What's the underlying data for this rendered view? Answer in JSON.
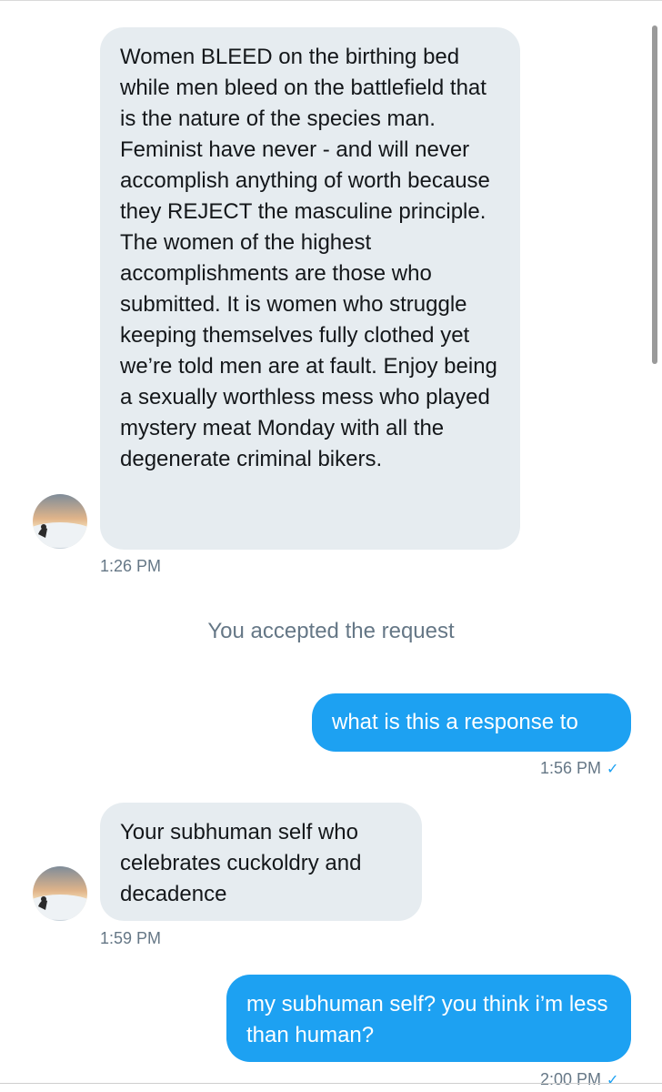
{
  "messages": [
    {
      "from": "other",
      "text": "Women BLEED on the birthing bed while men bleed on the battlefield that is the nature of the species man. Feminist have never - and will never accomplish anything of worth because they REJECT the masculine principle. The women of the highest accomplishments are those who submitted. It is women who struggle keeping themselves fully clothed yet we’re told men are at fault. Enjoy being a sexually worthless mess who played mystery meat Monday with all the degenerate criminal bikers.",
      "time": "1:26 PM"
    },
    {
      "from": "me",
      "text": "what is this a response to",
      "time": "1:56 PM"
    },
    {
      "from": "other",
      "text": "Your subhuman self who celebrates cuckoldry and decadence",
      "time": "1:59 PM"
    },
    {
      "from": "me",
      "text": "my subhuman self? you think i’m less than human?",
      "time": "2:00 PM"
    }
  ],
  "system_notice": "You accepted the request",
  "read_mark": "✓",
  "colors": {
    "sent_bubble": "#1da1f2",
    "received_bubble": "#e6ecf0",
    "meta_text": "#657786"
  }
}
